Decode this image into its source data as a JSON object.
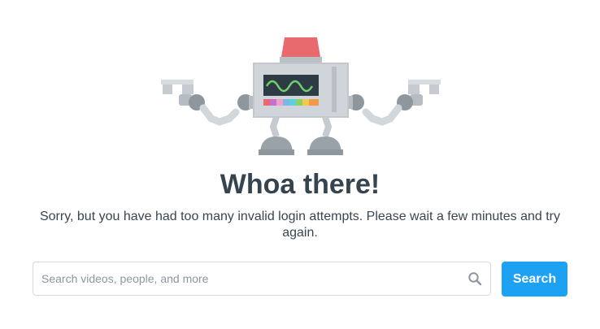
{
  "main": {
    "title": "Whoa there!",
    "message": "Sorry, but you have had too many invalid login attempts. Please wait a few minutes and try again."
  },
  "search": {
    "placeholder": "Search videos, people, and more",
    "value": "",
    "button_label": "Search"
  },
  "icons": {
    "illustration": "robot-illustration-icon",
    "search": "search-icon"
  },
  "colors": {
    "accent": "#1da1f2",
    "title": "#36444f",
    "siren": "#e96a6e"
  }
}
